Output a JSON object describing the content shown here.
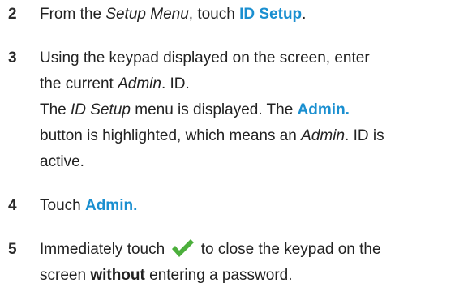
{
  "steps": [
    {
      "number": "2",
      "line1": {
        "t1": "From the ",
        "em1": "Setup Menu",
        "t2": ", touch ",
        "ui1": "ID Setup",
        "t3": "."
      }
    },
    {
      "number": "3",
      "line1": "Using the keypad displayed on the screen, enter",
      "line2": {
        "t1": "the current ",
        "em1": "Admin",
        "t2": ". ID."
      },
      "line3": {
        "t1": "The ",
        "em1": "ID Setup",
        "t2": " menu is displayed. The ",
        "ui1": "Admin."
      },
      "line4": {
        "t1": "button is highlighted, which means an ",
        "em1": "Admin",
        "t2": ". ID is"
      },
      "line5": "active."
    },
    {
      "number": "4",
      "line1": {
        "t1": "Touch ",
        "ui1": "Admin."
      }
    },
    {
      "number": "5",
      "line1": {
        "t1": "Immediately touch ",
        "icon": "checkmark-icon",
        "t2": " to close the keypad on the"
      },
      "line2": {
        "t1": "screen ",
        "strong1": "without",
        "t2": " entering a password."
      }
    }
  ],
  "colors": {
    "ui_accent": "#1a8fd0",
    "check_green": "#4caf3c",
    "text": "#222222"
  }
}
